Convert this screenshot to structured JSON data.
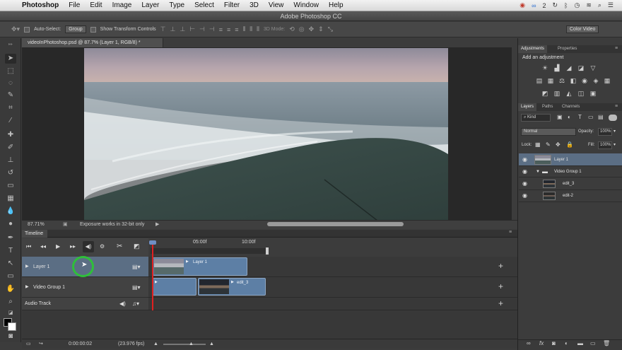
{
  "menubar": {
    "app_name": "Photoshop",
    "items": [
      "File",
      "Edit",
      "Image",
      "Layer",
      "Type",
      "Select",
      "Filter",
      "3D",
      "View",
      "Window",
      "Help"
    ],
    "badge_count": "2"
  },
  "window": {
    "title": "Adobe Photoshop CC"
  },
  "options": {
    "auto_select_label": "Auto-Select:",
    "auto_select_value": "Group",
    "show_transform_label": "Show Transform Controls",
    "mode_3d_label": "3D Mode:",
    "workspace": "Color Video"
  },
  "document": {
    "tab_title": "videoInPhotoshop.psd @ 87.7% (Layer 1, RGB/8) *",
    "zoom": "87.71%",
    "status_text": "Exposure works in 32-bit only"
  },
  "timeline": {
    "tab_label": "Timeline",
    "ruler_marks": [
      "05:00f",
      "10:00f"
    ],
    "rows": [
      {
        "label": "Layer 1"
      },
      {
        "label": "Video Group 1"
      },
      {
        "label": "Audio Track"
      }
    ],
    "clips": {
      "layer1": "Layer 1",
      "edit3": "edit_3"
    },
    "timecode": "0:00:00:02",
    "fps": "(23.976 fps)"
  },
  "adjustments": {
    "tab_adjustments": "Adjustments",
    "tab_properties": "Properties",
    "add_label": "Add an adjustment",
    "icons_row1": [
      "brightness-icon",
      "levels-icon",
      "curves-icon",
      "exposure-icon",
      "triangle-icon"
    ],
    "icons_row2": [
      "vibrance-icon",
      "hue-icon",
      "balance-icon",
      "bw-icon",
      "photo-filter-icon",
      "channel-mixer-icon",
      "grid-icon"
    ],
    "icons_row3": [
      "invert-icon",
      "posterize-icon",
      "threshold-icon",
      "selective-color-icon",
      "gradient-map-icon"
    ]
  },
  "layers": {
    "tab_layers": "Layers",
    "tab_paths": "Paths",
    "tab_channels": "Channels",
    "filter_kind": "Kind",
    "blend_mode": "Normal",
    "opacity_label": "Opacity:",
    "opacity_value": "100%",
    "lock_label": "Lock:",
    "fill_label": "Fill:",
    "fill_value": "100%",
    "items": [
      {
        "name": "Layer 1"
      },
      {
        "name": "Video Group 1"
      },
      {
        "name": "edit_3"
      },
      {
        "name": "edit-2"
      }
    ]
  },
  "colors": {
    "selection_blue": "#5b6e84",
    "clip_blue": "#5d7fa5",
    "playhead_red": "#e02020",
    "cursor_ring": "#2fbf3a"
  }
}
